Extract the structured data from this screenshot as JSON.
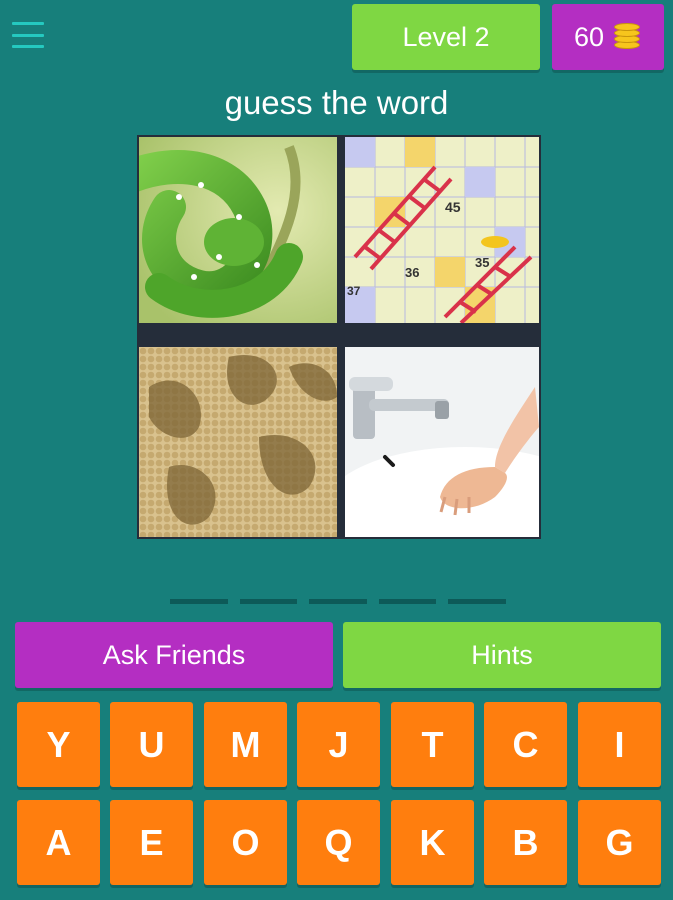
{
  "header": {
    "level_label": "Level 2",
    "coins": "60"
  },
  "prompt": "guess the word",
  "answer_slots": 5,
  "actions": {
    "ask_label": "Ask Friends",
    "hints_label": "Hints"
  },
  "keyboard": {
    "row1": [
      "Y",
      "U",
      "M",
      "J",
      "T",
      "C",
      "I"
    ],
    "row2": [
      "A",
      "E",
      "O",
      "Q",
      "K",
      "B",
      "G"
    ]
  },
  "images": [
    "green-snake-photo",
    "snakes-and-ladders-board-photo",
    "snakeskin-pattern-photo",
    "sink-faucet-and-hand-photo"
  ],
  "colors": {
    "background": "#177f7b",
    "green_button": "#7fd743",
    "purple_button": "#b42ec2",
    "key_orange": "#ff7e0e"
  }
}
